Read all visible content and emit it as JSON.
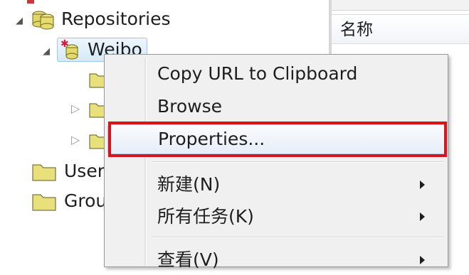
{
  "tree": {
    "repositories_label": "Repositories",
    "repo_label": "Weibo",
    "users_label": "User",
    "groups_label": "Grou"
  },
  "list": {
    "column_name": "名称"
  },
  "context_menu": {
    "items": [
      {
        "label": "Copy URL to Clipboard"
      },
      {
        "label": "Browse"
      },
      {
        "label": "Properties..."
      },
      {
        "label": "新建(N)"
      },
      {
        "label": "所有任务(K)"
      },
      {
        "label": "查看(V)"
      }
    ]
  },
  "colors": {
    "folder_fill": "#e8e07a",
    "selection": "#d4e9f9",
    "highlight_box": "#d7141a",
    "menu_bg": "#f0f0f0"
  }
}
